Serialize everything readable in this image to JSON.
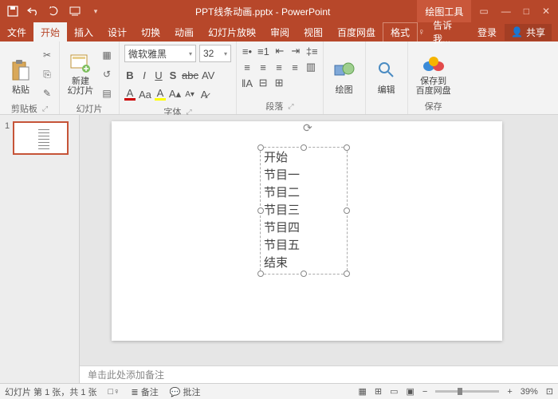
{
  "title": "PPT线条动画.pptx - PowerPoint",
  "drawingTools": "绘图工具",
  "tabs": {
    "file": "文件",
    "home": "开始",
    "insert": "插入",
    "design": "设计",
    "transition": "切换",
    "animation": "动画",
    "slideshow": "幻灯片放映",
    "review": "审阅",
    "view": "视图",
    "baidu": "百度网盘",
    "format": "格式"
  },
  "tellMe": "告诉我...",
  "login": "登录",
  "share": "共享",
  "ribbon": {
    "clipboard": {
      "paste": "粘贴",
      "label": "剪贴板"
    },
    "slides": {
      "newSlide": "新建\n幻灯片",
      "label": "幻灯片"
    },
    "font": {
      "name": "微软雅黑",
      "size": "32",
      "label": "字体"
    },
    "paragraph": {
      "label": "段落"
    },
    "drawing": {
      "draw": "绘图",
      "label": ""
    },
    "editing": {
      "edit": "编辑",
      "label": ""
    },
    "save": {
      "saveToBaidu": "保存到\n百度网盘",
      "label": "保存"
    }
  },
  "slide": {
    "lines": [
      "开始",
      "节目一",
      "节目二",
      "节目三",
      "节目四",
      "节目五",
      "结束"
    ]
  },
  "thumbNum": "1",
  "notesPlaceholder": "单击此处添加备注",
  "status": {
    "slideInfo": "幻灯片 第 1 张，共 1 张",
    "notes": "备注",
    "comments": "批注",
    "zoom": "39%"
  }
}
